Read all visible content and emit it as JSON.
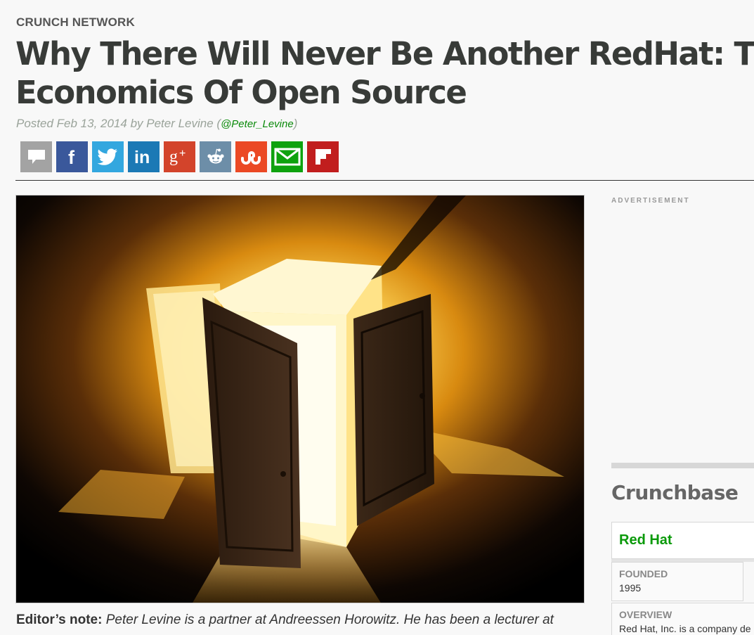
{
  "article": {
    "section": "CRUNCH NETWORK",
    "title": "Why There Will Never Be Another RedHat: The Economics Of Open Source",
    "byline_prefix": "Posted Feb 13, 2014 by Peter Levine (",
    "author_handle": "@Peter_Levine",
    "byline_suffix": ")",
    "editor_note_lead": "Editor’s note:",
    "editor_note_body": " Peter Levine is a partner at Andreessen Horowitz. He has been a lecturer at"
  },
  "share_buttons": [
    {
      "name": "comments",
      "icon": "comment-icon",
      "color": "#a3a3a3",
      "glyph": ""
    },
    {
      "name": "facebook",
      "icon": "facebook-icon",
      "color": "#3a589b",
      "glyph": "f"
    },
    {
      "name": "twitter",
      "icon": "twitter-icon",
      "color": "#33a7df",
      "glyph": ""
    },
    {
      "name": "linkedin",
      "icon": "linkedin-icon",
      "color": "#1b79b5",
      "glyph": "in"
    },
    {
      "name": "google-plus",
      "icon": "google-plus-icon",
      "color": "#d3442b",
      "glyph": "g+"
    },
    {
      "name": "reddit",
      "icon": "reddit-icon",
      "color": "#6d8ea8",
      "glyph": ""
    },
    {
      "name": "stumbleupon",
      "icon": "stumbleupon-icon",
      "color": "#eb4924",
      "glyph": ""
    },
    {
      "name": "email",
      "icon": "email-icon",
      "color": "#0ea20e",
      "glyph": ""
    },
    {
      "name": "flipboard",
      "icon": "flipboard-icon",
      "color": "#c11e1e",
      "glyph": ""
    }
  ],
  "sidebar": {
    "ad_label": "ADVERTISEMENT",
    "crunchbase_title": "Crunchbase",
    "company": "Red Hat",
    "founded_label": "FOUNDED",
    "founded_value": "1995",
    "overview_label": "OVERVIEW",
    "overview_value": "Red Hat, Inc. is a company de"
  }
}
